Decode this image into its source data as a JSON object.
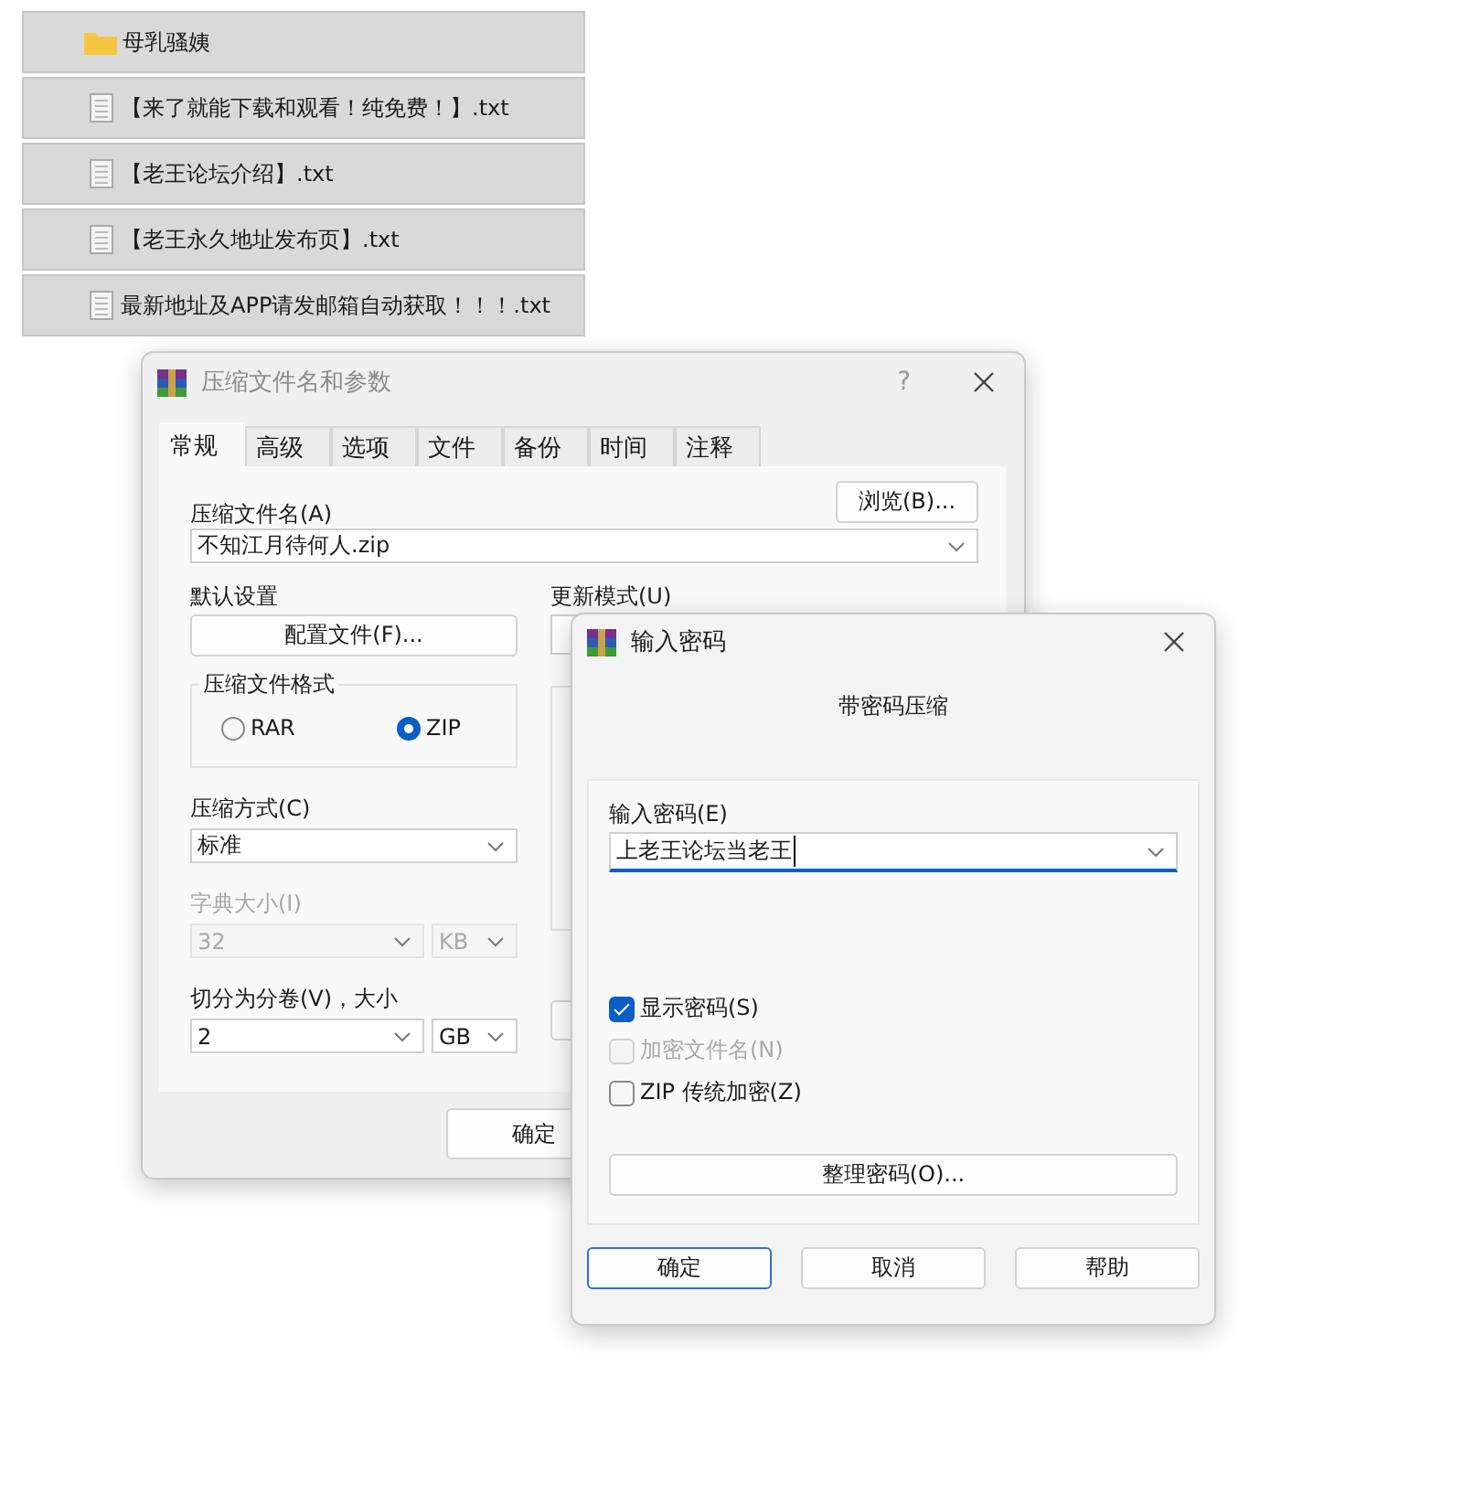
{
  "file_list": [
    {
      "kind": "folder",
      "name": "母乳骚姨"
    },
    {
      "kind": "text_file",
      "name": "【来了就能下载和观看！纯免费！】.txt"
    },
    {
      "kind": "text_file",
      "name": "【老王论坛介绍】.txt"
    },
    {
      "kind": "text_file",
      "name": "【老王永久地址发布页】.txt"
    },
    {
      "kind": "text_file",
      "name": "最新地址及APP请发邮箱自动获取！！！.txt"
    }
  ],
  "archive_dialog": {
    "title": "压缩文件名和参数",
    "help": "?",
    "tabs": [
      {
        "label": "常规",
        "selected": true
      },
      {
        "label": "高级",
        "selected": false
      },
      {
        "label": "选项",
        "selected": false
      },
      {
        "label": "文件",
        "selected": false
      },
      {
        "label": "备份",
        "selected": false
      },
      {
        "label": "时间",
        "selected": false
      },
      {
        "label": "注释",
        "selected": false
      }
    ],
    "archive_name": {
      "label": "压缩文件名(A)",
      "value": "不知江月待何人.zip",
      "browse_button": "浏览(B)..."
    },
    "default_settings": {
      "label": "默认设置",
      "button": "配置文件(F)..."
    },
    "update_mode": {
      "label": "更新模式(U)"
    },
    "format": {
      "title": "压缩文件格式",
      "options": [
        {
          "label": "RAR",
          "selected": false
        },
        {
          "label": "ZIP",
          "selected": true
        }
      ]
    },
    "method": {
      "label": "压缩方式(C)",
      "value": "标准",
      "disabled": false
    },
    "dictionary": {
      "label": "字典大小(I)",
      "value": "32",
      "unit": "KB",
      "disabled": true
    },
    "split": {
      "label": "切分为分卷(V)，大小",
      "value": "2",
      "unit": "GB",
      "disabled": false
    },
    "ok_button": "确定"
  },
  "password_dialog": {
    "title": "输入密码",
    "subtitle": "带密码压缩",
    "password_label": "输入密码(E)",
    "password_value": "上老王论坛当老王",
    "options": [
      {
        "label": "显示密码(S)",
        "checked": true,
        "disabled": false
      },
      {
        "label": "加密文件名(N)",
        "checked": false,
        "disabled": true
      },
      {
        "label": "ZIP 传统加密(Z)",
        "checked": false,
        "disabled": false
      }
    ],
    "organize_button": "整理密码(O)...",
    "buttons": [
      {
        "label": "确定",
        "default": true
      },
      {
        "label": "取消",
        "default": false
      },
      {
        "label": "帮助",
        "default": false
      }
    ]
  }
}
